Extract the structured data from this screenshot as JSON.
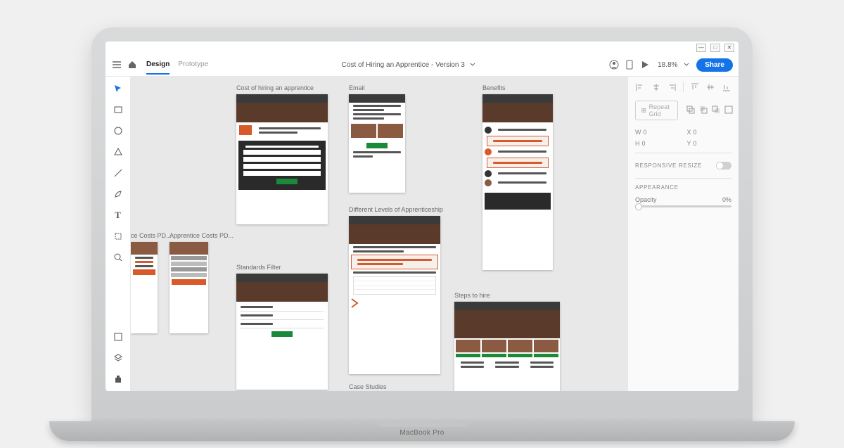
{
  "brand": "MacBook Pro",
  "window": {
    "minimize": "—",
    "maximize": "□",
    "close": "✕"
  },
  "topbar": {
    "tabs": {
      "design": "Design",
      "prototype": "Prototype"
    },
    "document": "Cost of Hiring an Apprentice - Version 3",
    "zoom": "18.8%",
    "share": "Share"
  },
  "tools": [
    "select",
    "rectangle",
    "ellipse",
    "polygon",
    "line",
    "pen",
    "text",
    "artboard",
    "zoom"
  ],
  "artboards": {
    "a1": "Cost of hiring an apprentice",
    "a2": "Email",
    "a3": "Benefits",
    "a4": "ce Costs PD...",
    "a5": "Apprentice Costs PD...",
    "a6": "Standards Filter",
    "a7": "Different Levels of Apprenticeship",
    "a8": "Steps to hire",
    "a9": "Case Studies"
  },
  "panel": {
    "repeat": "Repeat Grid",
    "w_label": "W",
    "w_val": "0",
    "x_label": "X",
    "x_val": "0",
    "h_label": "H",
    "h_val": "0",
    "y_label": "Y",
    "y_val": "0",
    "resize": "RESPONSIVE RESIZE",
    "appearance": "APPEARANCE",
    "opacity_label": "Opacity",
    "opacity_val": "0%"
  }
}
